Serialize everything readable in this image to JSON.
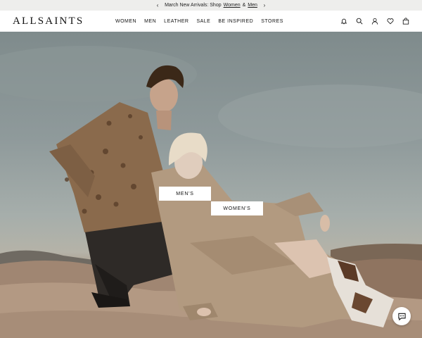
{
  "announcement": {
    "prefix": "March New Arrivals: Shop",
    "women_link": "Women",
    "conjunction": "&",
    "men_link": "Men",
    "prev_icon": "chevron-left-icon",
    "next_icon": "chevron-right-icon"
  },
  "header": {
    "logo": "ALLSAINTS",
    "nav": [
      {
        "label": "WOMEN"
      },
      {
        "label": "MEN"
      },
      {
        "label": "LEATHER"
      },
      {
        "label": "SALE"
      },
      {
        "label": "BE INSPIRED"
      },
      {
        "label": "STORES"
      }
    ],
    "icons": [
      "bell-icon",
      "search-icon",
      "account-icon",
      "wishlist-heart-icon",
      "bag-icon"
    ]
  },
  "hero": {
    "mens_cta": "MEN'S",
    "womens_cta": "WOMEN'S"
  },
  "chat": {
    "icon": "chat-bubble-icon"
  },
  "colors": {
    "announcement_bg": "#eeeeec",
    "text": "#111111",
    "sky": "#8f9a9b",
    "rock": "#a38d79"
  }
}
